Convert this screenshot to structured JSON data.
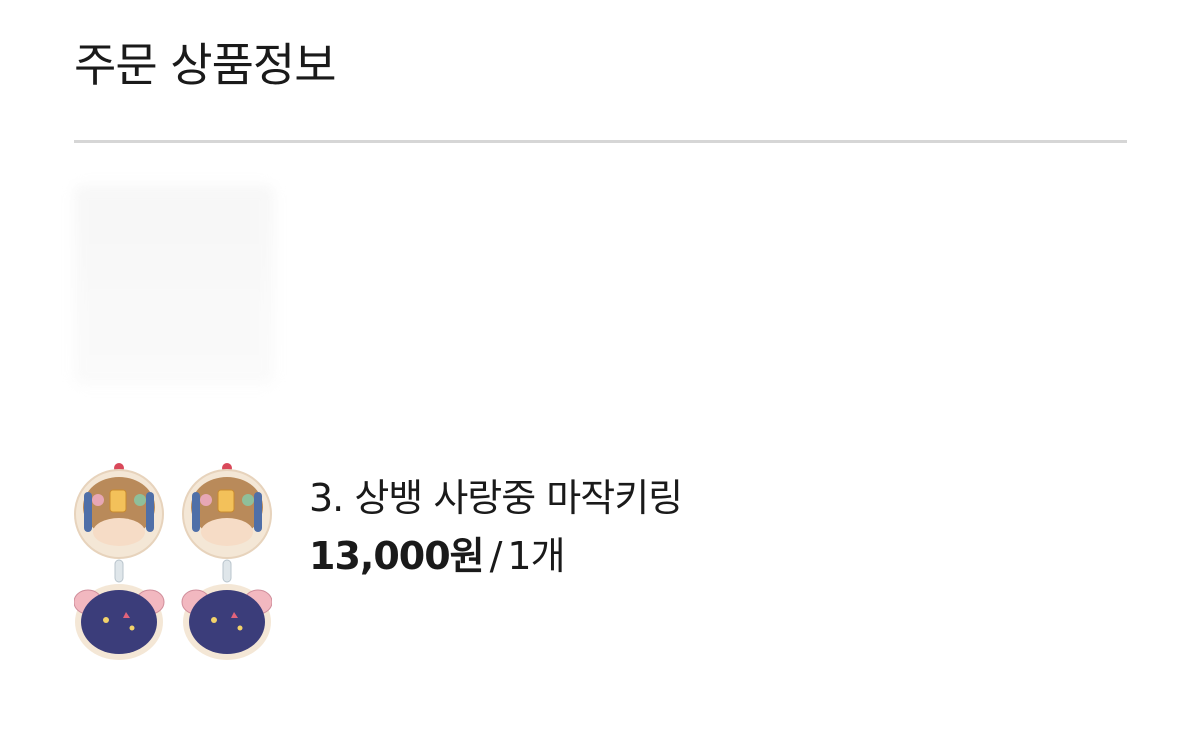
{
  "page": {
    "section_title": "주문 상품정보"
  },
  "ghost_item": {
    "name": "",
    "price": "",
    "note": ""
  },
  "order_item": {
    "image_icon": "acrylic-keyring-product-image",
    "name": "3. 상뱅 사랑중 마작키링",
    "price": "13,000원",
    "separator": "/",
    "quantity": "1개"
  },
  "colors": {
    "divider": "#d6d6d6",
    "text": "#1a1a1a",
    "keyring_navy": "#3b3d7a",
    "keyring_brown": "#b98a5a",
    "keyring_pink": "#f2b8c0"
  }
}
